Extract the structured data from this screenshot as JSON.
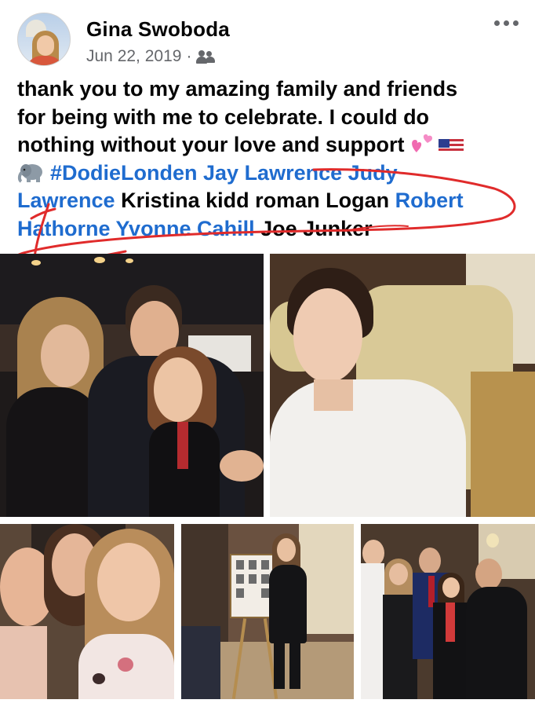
{
  "post": {
    "author": "Gina Swoboda",
    "date": "Jun 22, 2019",
    "separator": "·",
    "audience_icon": "friends-icon",
    "more_icon": "more-options-icon",
    "text_lines": [
      [
        "thank you to my amazing family and friends"
      ],
      [
        "for being with me to celebrate. I could do"
      ],
      [
        "nothing without your love and support"
      ]
    ],
    "tags": {
      "hashtag": "#DodieLonden",
      "jay": "Jay Lawrence",
      "judy": "Judy",
      "lawrence": "Lawrence",
      "kristina": "Kristina kidd roman Logan",
      "robert": "Robert",
      "hathorne": "Hathorne",
      "yvonne": "Yvonne Cahill",
      "joe": "Joe Junker"
    },
    "emoji": [
      "growing-heart-emoji",
      "us-flag-emoji",
      "elephant-emoji"
    ]
  },
  "colors": {
    "link": "#1f6ccf",
    "text": "#050505",
    "meta": "#65676b",
    "annotation": "#e02b2b"
  },
  "photos": [
    {
      "name": "photo-group-restaurant"
    },
    {
      "name": "photo-young-man-armchair"
    },
    {
      "name": "photo-selfie-three"
    },
    {
      "name": "photo-woman-with-poster"
    },
    {
      "name": "photo-group-six"
    }
  ]
}
